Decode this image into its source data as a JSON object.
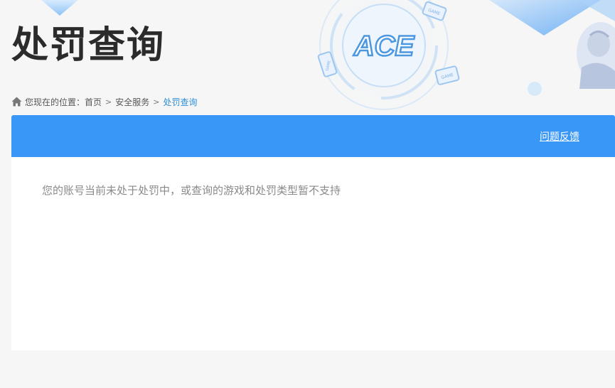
{
  "header": {
    "title": "处罚查询"
  },
  "breadcrumb": {
    "prefix": "您现在的位置：",
    "items": [
      "首页",
      "安全服务",
      "处罚查询"
    ],
    "separator": ">"
  },
  "panel": {
    "feedback_label": "问题反馈",
    "message": "您的账号当前未处于处罚中，或查询的游戏和处罚类型暂不支持"
  },
  "decor": {
    "logo_text": "ACE",
    "badge_text": "GAME"
  },
  "colors": {
    "accent": "#3897f7",
    "link_current": "#2f8fd8",
    "title": "#2b2b2b",
    "message": "#8a8a8a"
  }
}
